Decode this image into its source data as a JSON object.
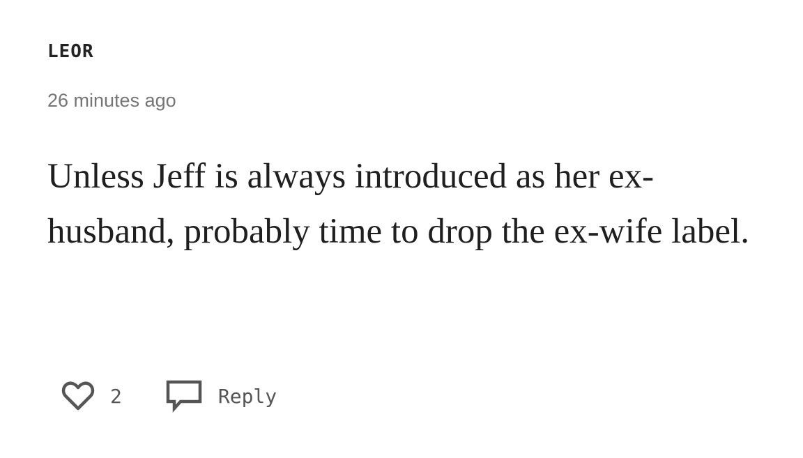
{
  "comment": {
    "author": "LEOR",
    "timestamp": "26 minutes ago",
    "text": "Unless Jeff is always introduced as her ex-husband, probably time to drop the ex-wife label.",
    "actions": {
      "like_icon": "heart-icon",
      "like_count": "2",
      "reply_icon": "comment-icon",
      "reply_label": "Reply"
    }
  }
}
